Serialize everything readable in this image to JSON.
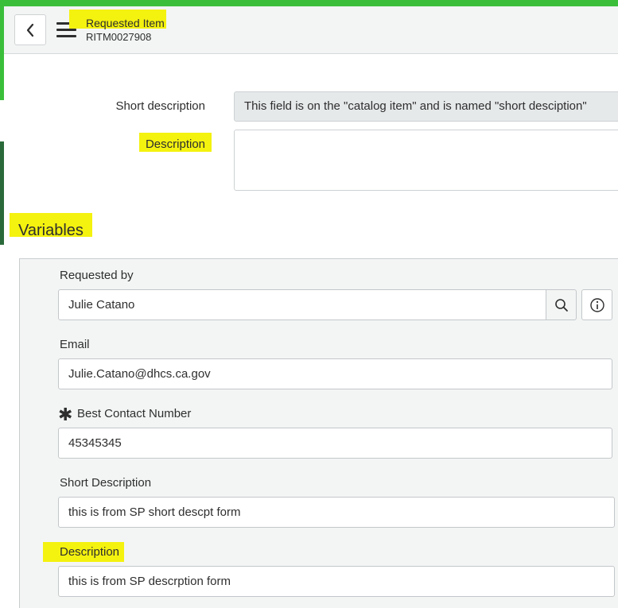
{
  "header": {
    "title": "Requested Item",
    "record_number": "RITM0027908",
    "back_icon": "chevron-left-icon",
    "menu_icon": "hamburger-menu-icon"
  },
  "form": {
    "short_description": {
      "label": "Short description",
      "value": "This field is on the \"catalog item\" and  is named \"short desciption\""
    },
    "description": {
      "label": "Description",
      "value": ""
    }
  },
  "variables": {
    "title": "Variables",
    "requested_by": {
      "label": "Requested by",
      "value": "Julie Catano",
      "search_icon": "search-icon",
      "info_icon": "info-icon"
    },
    "email": {
      "label": "Email",
      "value": "Julie.Catano@dhcs.ca.gov"
    },
    "best_contact_number": {
      "label": "Best Contact Number",
      "required_marker": "✱",
      "value": "45345345"
    },
    "short_description": {
      "label": "Short Description",
      "value": "this is from SP short descpt form"
    },
    "description": {
      "label": "Description",
      "value": "this is from SP descrption form"
    }
  },
  "colors": {
    "highlight": "#f4f20f",
    "accent_green": "#3bbf3b",
    "header_bg": "#f3f5f5",
    "readonly_bg": "#e6e9ea"
  }
}
